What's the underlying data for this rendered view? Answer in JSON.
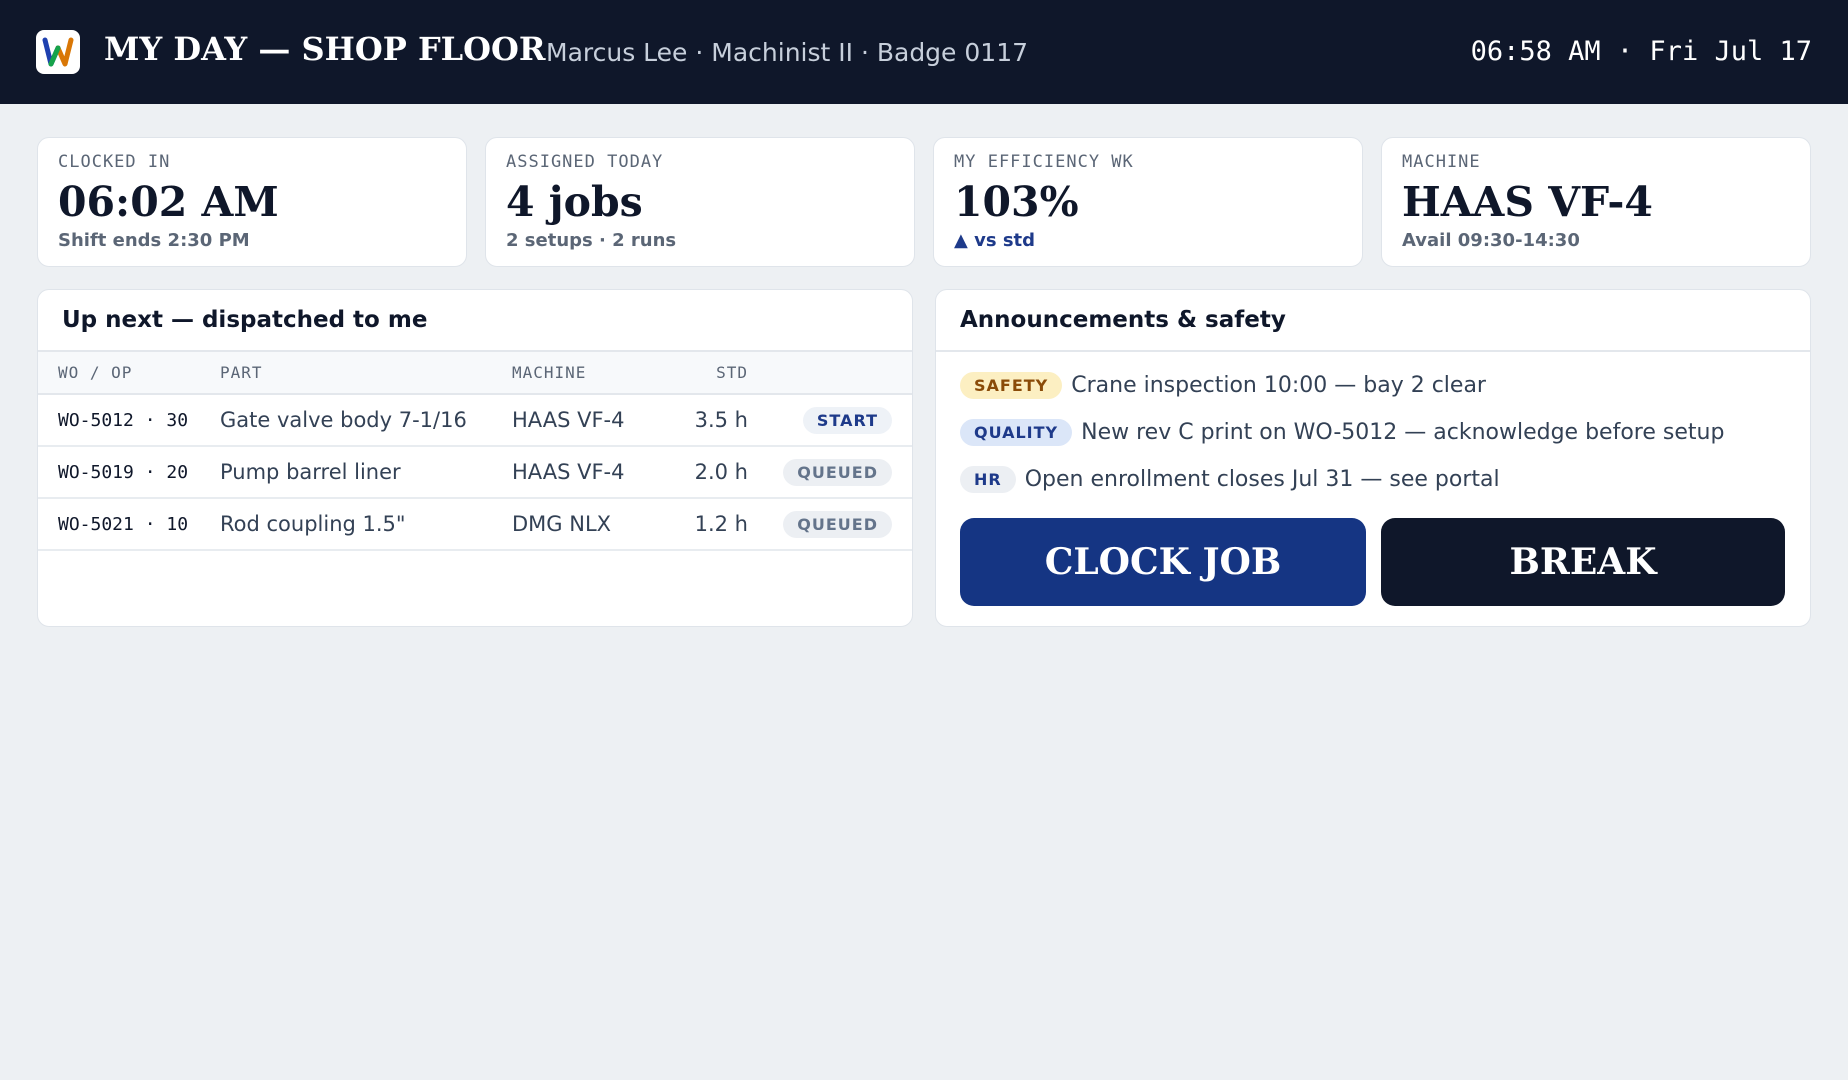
{
  "header": {
    "app_title": "MY DAY — SHOP FLOOR",
    "user_info": "Marcus Lee · Machinist II · Badge 0117",
    "clock": "06:58 AM · Fri Jul 17",
    "logo_letter": "W"
  },
  "kpis": [
    {
      "label": "CLOCKED IN",
      "value": "06:02 AM",
      "sub": "Shift ends 2:30 PM"
    },
    {
      "label": "ASSIGNED TODAY",
      "value": "4 jobs",
      "sub": "2 setups · 2 runs"
    },
    {
      "label": "MY EFFICIENCY WK",
      "value": "103%",
      "sub": "▲ vs std"
    },
    {
      "label": "MACHINE",
      "value": "HAAS VF-4",
      "sub": "Avail 09:30-14:30"
    }
  ],
  "up_next": {
    "title": "Up next — dispatched to me",
    "columns": [
      "WO / OP",
      "PART",
      "MACHINE",
      "STD"
    ],
    "rows": [
      {
        "wo": "WO-5012 · 30",
        "part": "Gate valve body 7-1/16",
        "machine": "HAAS VF-4",
        "std": "3.5 h",
        "action": "START"
      },
      {
        "wo": "WO-5019 · 20",
        "part": "Pump barrel liner",
        "machine": "HAAS VF-4",
        "std": "2.0 h",
        "action": "QUEUED"
      },
      {
        "wo": "WO-5021 · 10",
        "part": "Rod coupling 1.5\"",
        "machine": "DMG NLX",
        "std": "1.2 h",
        "action": "QUEUED"
      }
    ]
  },
  "announcements": {
    "title": "Announcements & safety",
    "items": [
      {
        "tag": "SAFETY",
        "text": "Crane inspection 10:00 — bay 2 clear"
      },
      {
        "tag": "QUALITY",
        "text": "New rev C print on WO-5012 — acknowledge before setup"
      },
      {
        "tag": "HR",
        "text": "Open enrollment closes Jul 31 — see portal"
      }
    ]
  },
  "actions": {
    "clock_job": "CLOCK JOB",
    "break": "BREAK"
  },
  "colors": {
    "header_bg": "#0f172a",
    "accent_blue": "#153583",
    "safety_tag": "#fcefc2",
    "quality_tag": "#dbe6f8"
  }
}
